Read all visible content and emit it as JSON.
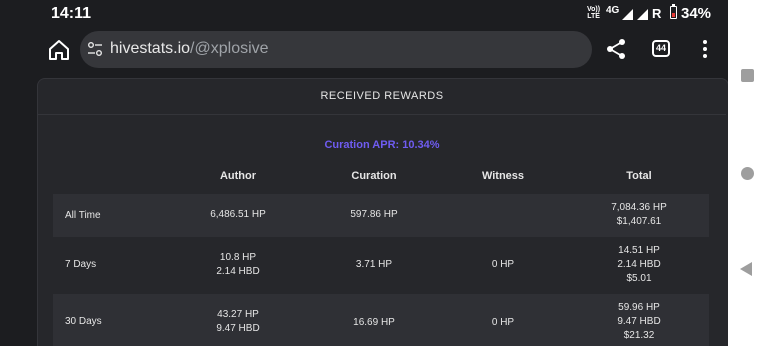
{
  "status_bar": {
    "time": "14:11",
    "volte_top": "Vo))",
    "volte_bottom": "LTE",
    "network": "4G",
    "roaming": "R",
    "battery": "34%"
  },
  "browser": {
    "url_domain": "hivestats.io",
    "url_path": "/@xplosive",
    "tab_count": "44"
  },
  "card": {
    "title": "RECEIVED REWARDS",
    "curation_apr": "Curation APR: 10.34%"
  },
  "table": {
    "headers": [
      "Author",
      "Curation",
      "Witness",
      "Total"
    ],
    "rows": [
      {
        "label": "All Time",
        "author": [
          "6,486.51 HP"
        ],
        "curation": [
          "597.86 HP"
        ],
        "witness": [],
        "total": [
          "7,084.36 HP",
          "$1,407.61"
        ]
      },
      {
        "label": "7 Days",
        "author": [
          "10.8 HP",
          "2.14 HBD"
        ],
        "curation": [
          "3.71 HP"
        ],
        "witness": [
          "0 HP"
        ],
        "total": [
          "14.51 HP",
          "2.14 HBD",
          "$5.01"
        ]
      },
      {
        "label": "30 Days",
        "author": [
          "43.27 HP",
          "9.47 HBD"
        ],
        "curation": [
          "16.69 HP"
        ],
        "witness": [
          "0 HP"
        ],
        "total": [
          "59.96 HP",
          "9.47 HBD",
          "$21.32"
        ]
      }
    ]
  },
  "colors": {
    "background": "#1c1d20",
    "card": "#26272b",
    "row_alt": "#2f3035",
    "accent": "#6f5cf2",
    "battery_low": "#e53935"
  },
  "icons": [
    "home-icon",
    "tune-icon",
    "share-icon",
    "tabs-icon",
    "more-vert-icon",
    "overview-icon",
    "home-nav-icon",
    "back-icon"
  ]
}
